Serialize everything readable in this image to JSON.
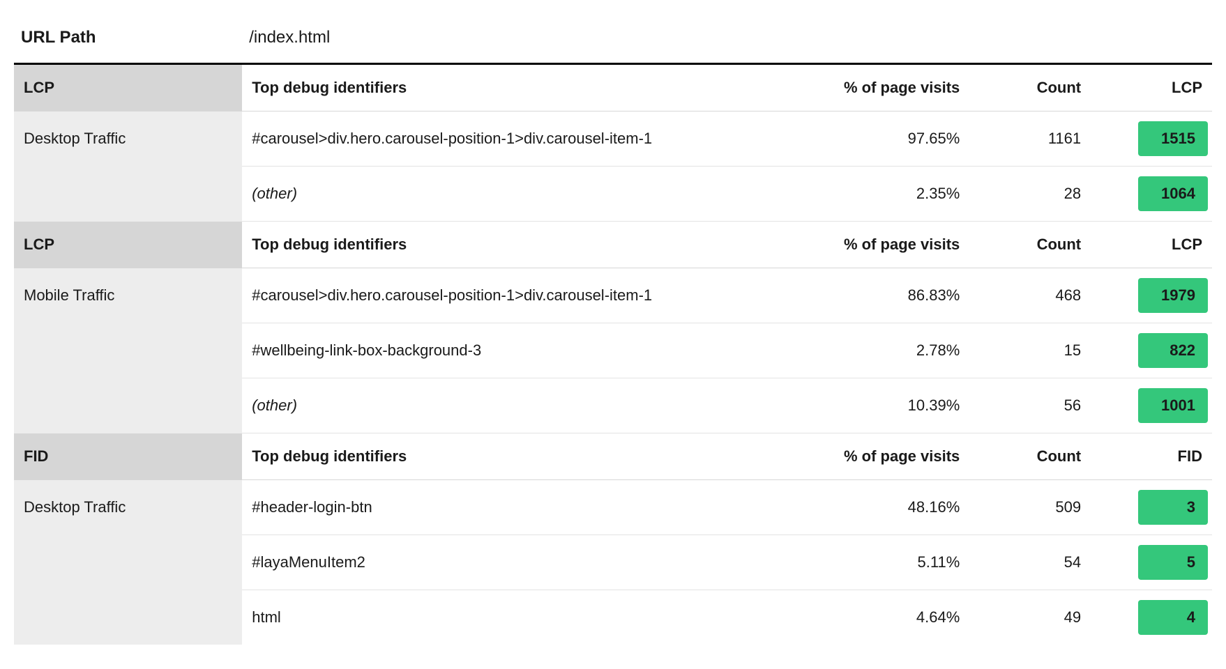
{
  "header": {
    "url_path_label": "URL Path",
    "url_path_value": "/index.html"
  },
  "columns": {
    "debug": "Top debug identifiers",
    "visits": "% of page visits",
    "count": "Count"
  },
  "sections": [
    {
      "metric_label": "LCP",
      "traffic_label": "Desktop Traffic",
      "rows": [
        {
          "debug": "#carousel>div.hero.carousel-position-1>div.carousel-item-1",
          "visits": "97.65%",
          "count": "1161",
          "metric": "1515",
          "italic": false
        },
        {
          "debug": "(other)",
          "visits": "2.35%",
          "count": "28",
          "metric": "1064",
          "italic": true
        }
      ]
    },
    {
      "metric_label": "LCP",
      "traffic_label": "Mobile Traffic",
      "rows": [
        {
          "debug": "#carousel>div.hero.carousel-position-1>div.carousel-item-1",
          "visits": "86.83%",
          "count": "468",
          "metric": "1979",
          "italic": false
        },
        {
          "debug": "#wellbeing-link-box-background-3",
          "visits": "2.78%",
          "count": "15",
          "metric": "822",
          "italic": false
        },
        {
          "debug": "(other)",
          "visits": "10.39%",
          "count": "56",
          "metric": "1001",
          "italic": true
        }
      ]
    },
    {
      "metric_label": "FID",
      "traffic_label": "Desktop Traffic",
      "rows": [
        {
          "debug": "#header-login-btn",
          "visits": "48.16%",
          "count": "509",
          "metric": "3",
          "italic": false
        },
        {
          "debug": "#layaMenuItem2",
          "visits": "5.11%",
          "count": "54",
          "metric": "5",
          "italic": false
        },
        {
          "debug": "html",
          "visits": "4.64%",
          "count": "49",
          "metric": "4",
          "italic": false
        }
      ]
    }
  ]
}
